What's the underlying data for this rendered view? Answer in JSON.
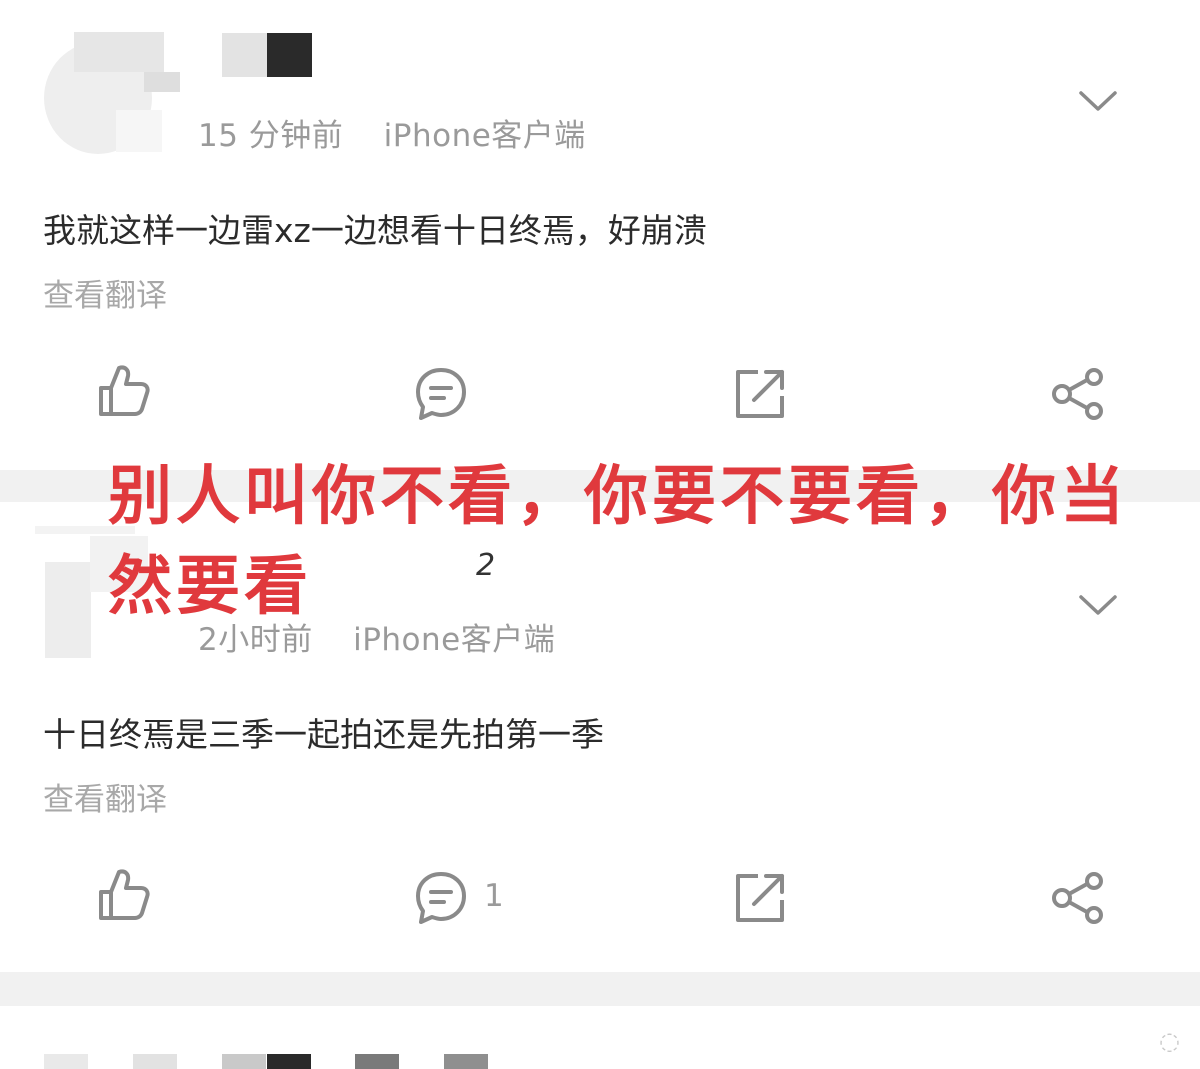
{
  "posts": [
    {
      "time": "15 分钟前",
      "client": "iPhone客户端",
      "content": "我就这样一边雷xz一边想看十日终焉，好崩溃",
      "translate": "查看翻译",
      "comment_count": ""
    },
    {
      "time": "2小时前",
      "client": "iPhone客户端",
      "content": "十日终焉是三季一起拍还是先拍第一季",
      "translate": "查看翻译",
      "comment_count": "1"
    }
  ],
  "overlay_text": "别人叫你不看，你要不要看，你当然要看",
  "stray_mark": "2",
  "colors": {
    "overlay": "#e0393d",
    "icon": "#8a8a8a",
    "meta": "#9a9a9a",
    "separator": "#f1f1f1"
  },
  "icons": [
    "like-icon",
    "comment-icon",
    "repost-icon",
    "share-icon",
    "chevron-down-icon"
  ]
}
